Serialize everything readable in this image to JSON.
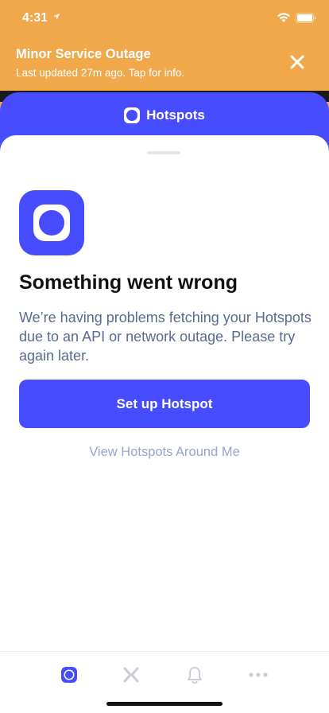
{
  "status_bar": {
    "time": "4:31"
  },
  "banner": {
    "title": "Minor Service Outage",
    "subtitle": "Last updated 27m ago. Tap for info.",
    "close_icon": "close-icon"
  },
  "sheet": {
    "title": "Hotspots"
  },
  "error": {
    "title": "Something went wrong",
    "message": "We’re having problems fetching your Hotspots due to an API or network outage. Please try again later."
  },
  "actions": {
    "primary_label": "Set up Hotspot",
    "secondary_label": "View Hotspots Around Me"
  },
  "tabbar": {
    "tabs": [
      {
        "icon": "hotspot-icon",
        "active": true
      },
      {
        "icon": "transfer-icon",
        "active": false
      },
      {
        "icon": "bell-icon",
        "active": false
      },
      {
        "icon": "more-icon",
        "active": false
      }
    ]
  },
  "colors": {
    "banner": "#F0A84A",
    "accent": "#474DFF",
    "body_text": "#5A6A8E",
    "link_text": "#9AA3CF",
    "inactive_icon": "#C9CDDB"
  }
}
